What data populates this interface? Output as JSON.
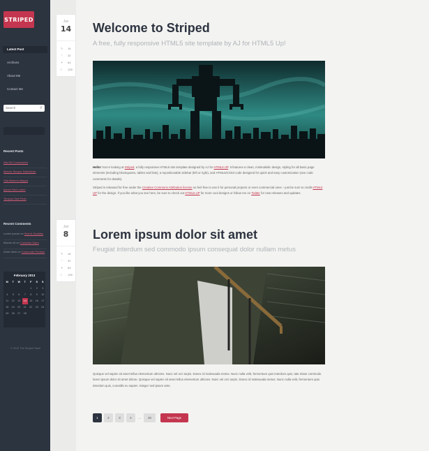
{
  "sidebar": {
    "logo": "STRIPED",
    "nav": [
      "Latest Post",
      "Archives",
      "About Me",
      "Contact Me"
    ],
    "search_placeholder": "Search",
    "recent_posts_title": "Recent Posts",
    "recent_posts": [
      "Nisi Sit Consectetur",
      "Mauris Tempor Sollicitudin",
      "Vita Misteris Magna",
      "Ipsum Sed Lorem",
      "Tempus Sed Pede"
    ],
    "recent_comments_title": "Recent Comments",
    "recent_comments": [
      {
        "who": "Lorem ipsum",
        "on": "on",
        "link": "Sed et Sodales"
      },
      {
        "who": "Mauris sit",
        "on": "on",
        "link": "Curabitur Diam"
      },
      {
        "who": "Amet diam",
        "on": "on",
        "link": "Commodo Pretium"
      }
    ],
    "calendar": {
      "title": "February 2013",
      "headers": [
        "M",
        "T",
        "W",
        "T",
        "F",
        "S",
        "S"
      ],
      "rows": [
        [
          "",
          "",
          "",
          "",
          "1",
          "2",
          "3"
        ],
        [
          "4",
          "5",
          "6",
          "7",
          "8",
          "9",
          "10"
        ],
        [
          "11",
          "12",
          "13",
          "14",
          "15",
          "16",
          "17"
        ],
        [
          "18",
          "19",
          "20",
          "21",
          "22",
          "23",
          "24"
        ],
        [
          "25",
          "26",
          "27",
          "28",
          "",
          "",
          ""
        ]
      ],
      "today": "14"
    },
    "copyright": "© 2013 The Striped Team"
  },
  "posts": [
    {
      "month": "Jan",
      "day": "14",
      "stats": [
        {
          "icon": "chat-icon",
          "glyph": "✎",
          "value": "16"
        },
        {
          "icon": "heart-icon",
          "glyph": "♡",
          "value": "32"
        },
        {
          "icon": "twitter-icon",
          "glyph": "✦",
          "value": "64"
        },
        {
          "icon": "facebook-icon",
          "glyph": "f",
          "value": "128"
        }
      ],
      "title": "Welcome to Striped",
      "subtitle": "A free, fully responsive HTML5 site template by AJ for HTML5 Up!",
      "para1_lead": "Hello!",
      "para1_a": "You're looking at",
      "para1_link1": "Striped",
      "para1_b": ", a fully responsive HTML5 site template designed by AJ for",
      "para1_link2": "HTML5 UP",
      "para1_c": ". It features a clean, minimalistic design, styling for all basic page elements (including blockquotes, tables and lists), a repositionable sidebar (left or right), and HTML5/CSS3 code designed for quick and easy customization (see code comments for details).",
      "para2_a": "Striped is released for free under the",
      "para2_link1": "Creative Commons Attribution license",
      "para2_b": "so feel free to use it for personal projects or even commercial ones – just be sure to credit",
      "para2_link2": "HTML5 UP",
      "para2_c": "for the design. If you like what you see here, be sure to check out",
      "para2_link3": "HTML5 UP",
      "para2_d": "for more cool designs or follow me on",
      "para2_link4": "Twitter",
      "para2_e": "for new releases and updates."
    },
    {
      "month": "Jan",
      "day": "8",
      "stats": [
        {
          "icon": "chat-icon",
          "glyph": "✎",
          "value": "16"
        },
        {
          "icon": "heart-icon",
          "glyph": "♡",
          "value": "32"
        },
        {
          "icon": "twitter-icon",
          "glyph": "✦",
          "value": "64"
        },
        {
          "icon": "facebook-icon",
          "glyph": "f",
          "value": "128"
        }
      ],
      "title": "Lorem ipsum dolor sit amet",
      "subtitle": "Feugiat interdum sed commodo ipsum consequat dolor nullam metus",
      "para1": "Quisque vel sapien sit amet tellus elementum ultricies. Nunc vel orci turpis. Donec id malesuada metus. Nunc nulla velit, fermentum quis interdum quis, tate etiam commodo lorem ipsum dolor sit amet dolore. Quisque vel sapien sit amet tellus elementum ultricies. Nunc vel orci turpis. Donec id malesuada metus. Nunc nulla velit, fermentum quis interdum quis, convallis eu sapien. Integer sed ipsum ante."
    }
  ],
  "pagination": {
    "pages": [
      "1",
      "2",
      "3",
      "4",
      "…",
      "20"
    ],
    "current": "1",
    "next_label": "Next Page"
  },
  "colors": {
    "accent": "#c4364f",
    "sidebar": "#2c3440",
    "title": "#2d3440"
  }
}
